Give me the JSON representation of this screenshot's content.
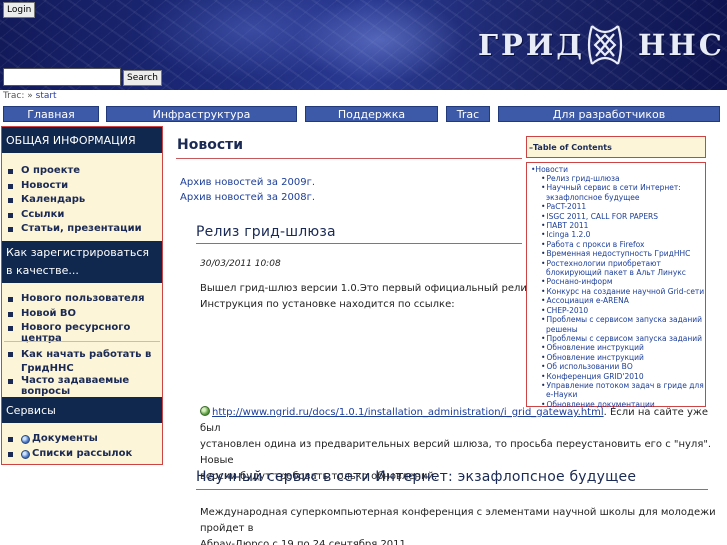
{
  "header": {
    "login_label": "Login",
    "search_placeholder": "",
    "search_button": "Search",
    "logo_left": "ГРИД",
    "logo_right": "ННС"
  },
  "breadcrumb": {
    "prefix": "Trac: »",
    "current": "start"
  },
  "nav": [
    "Главная",
    "Инфраструктура",
    "Поддержка",
    "Trac",
    "Для разработчиков"
  ],
  "sidebar": {
    "general_title": "ОБЩАЯ ИНФОРМАЦИЯ",
    "general_items": [
      "О проекте",
      "Новости",
      "Календарь",
      "Ссылки",
      "Статьи, презентации"
    ],
    "register_title": "Как зарегистрироваться в качестве...",
    "register_items": [
      "Нового пользователя",
      "Новой ВО",
      "Нового ресурсного центра"
    ],
    "help_items": [
      "Как начать работать в ГридННС",
      "Часто задаваемые вопросы"
    ],
    "services_title": "Сервисы",
    "services_items": [
      "Документы",
      "Списки рассылок"
    ]
  },
  "main": {
    "title": "Новости",
    "archives": [
      "Архив новостей за 2009г.",
      "Архив новостей за 2008г."
    ],
    "post1": {
      "title": "Релиз грид-шлюза",
      "date": "30/03/2011 10:08",
      "line1": "Вышел грид-шлюз версии 1.0.Это первый официальный релиз.",
      "line2": "Инструкция по установке находится по ссылке:",
      "link": "http://www.ngrid.ru/docs/1.0.1/installation_administration/i_grid_gateway.html",
      "after_link": ". Если на сайте уже был",
      "line4": "установлен одина из предварительных версий шлюза, то просьба переустановить его с \"нуля\". Новые",
      "line5": "версии будут требовать только обновлений."
    },
    "post2": {
      "title": "Научный сервис в сети Интернет: экзафлопсное будущее",
      "line1": "Международная суперкомпьютерная конференция с элементами научной школы для молодежи пройдет в",
      "line2": "Абрау-Дюрсо с 19 по 24 сентября 2011."
    }
  },
  "toc": {
    "title": "–Table of Contents",
    "root": "•Новости",
    "items": [
      "Релиз грид-шлюза",
      "Научный сервис в сети Интернет:",
      "экзафлопсное будущее",
      "PaCT-2011",
      "ISGC 2011, CALL FOR PAPERS",
      "ПАВТ 2011",
      "Icinga 1.2.0",
      "Работа с прокси в Firefox",
      "Временная недоступность ГридННС",
      "Ростехнологии приобретают",
      "блокирующий пакет в Альт Линукс",
      "Роснано-информ",
      "Конкурс на создание научной Grid-сети",
      "Ассоциация e-ARENA",
      "CHEP-2010",
      "Проблемы с сервисом запуска заданий",
      "решены",
      "Проблемы с сервисом запуска заданий",
      "Обновление инструкций",
      "Обновление инструкций",
      "Об использовании ВО",
      "Конференция GRID'2010",
      "Управление потоком задач в гриде для",
      "e-Науки",
      "Обновление документации"
    ]
  }
}
